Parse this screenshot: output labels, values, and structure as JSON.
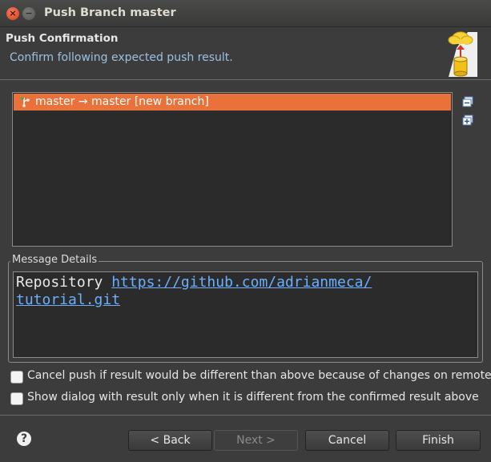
{
  "window": {
    "title": "Push Branch master",
    "close_glyph": "×",
    "minimize_glyph": "−"
  },
  "header": {
    "title": "Push Confirmation",
    "description": "Confirm following expected push result.",
    "icon": "push-to-cloud-icon"
  },
  "refs": [
    {
      "label": "master → master [new branch]",
      "icon": "new-branch-icon",
      "selected": true
    }
  ],
  "side_buttons": {
    "collapse_icon": "collapse-all-icon",
    "expand_icon": "expand-all-icon"
  },
  "message_details": {
    "label": "Message Details",
    "prefix": "Repository ",
    "url_line1": "https://github.com/adrianmeca/",
    "url_line2": "tutorial.git"
  },
  "options": {
    "cancel_push": {
      "label": "Cancel push if result would be different than above because of changes on remote",
      "checked": false
    },
    "show_dialog": {
      "label": "Show dialog with result only when it is different from the confirmed result above",
      "checked": false
    }
  },
  "footer": {
    "help_glyph": "?",
    "back": "< Back",
    "next": "Next >",
    "cancel": "Cancel",
    "finish": "Finish"
  },
  "colors": {
    "selection": "#e9713a",
    "link": "#6bb0ff",
    "background": "#3c3c3c"
  }
}
